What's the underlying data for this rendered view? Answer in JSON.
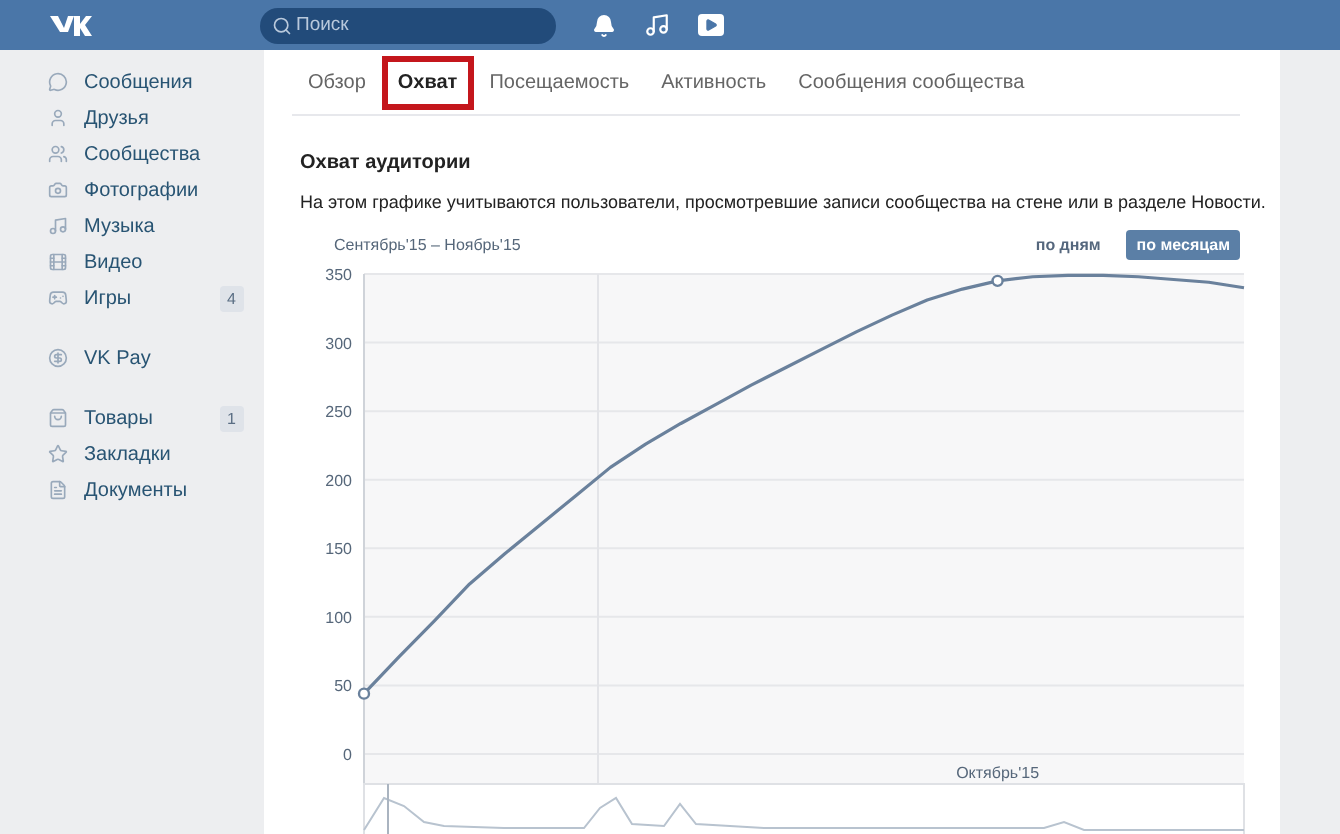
{
  "header": {
    "search": {
      "placeholder": "Поиск"
    }
  },
  "sidebar": {
    "groups": [
      [
        {
          "label": "Сообщения"
        },
        {
          "label": "Друзья"
        },
        {
          "label": "Сообщества"
        },
        {
          "label": "Фотографии"
        },
        {
          "label": "Музыка"
        },
        {
          "label": "Видео"
        },
        {
          "label": "Игры",
          "badge": "4"
        }
      ],
      [
        {
          "label": "VK Pay"
        }
      ],
      [
        {
          "label": "Товары",
          "badge": "1"
        },
        {
          "label": "Закладки"
        },
        {
          "label": "Документы"
        }
      ]
    ]
  },
  "tabs": [
    {
      "label": "Обзор",
      "selected": false,
      "highlighted": false
    },
    {
      "label": "Охват",
      "selected": true,
      "highlighted": true
    },
    {
      "label": "Посещаемость",
      "selected": false,
      "highlighted": false
    },
    {
      "label": "Активность",
      "selected": false,
      "highlighted": false
    },
    {
      "label": "Сообщения сообщества",
      "selected": false,
      "highlighted": false
    }
  ],
  "section": {
    "title": "Охват аудитории",
    "description": "На этом графике учитываются пользователи, просмотревшие записи сообщества на стене или в разделе Новости."
  },
  "chart": {
    "period": "Сентябрь'15 – Ноябрь'15",
    "modes": [
      {
        "label": "по дням",
        "selected": false
      },
      {
        "label": "по месяцам",
        "selected": true
      }
    ],
    "chart_data": {
      "type": "line",
      "categories": [
        null,
        null,
        null,
        null,
        null,
        null,
        null,
        null,
        null,
        null,
        null,
        null,
        null,
        null,
        null,
        null,
        null,
        null,
        null,
        null,
        null,
        null,
        null,
        null,
        null,
        null
      ],
      "ylim": [
        0,
        350
      ],
      "grid": true,
      "yticks": [
        {
          "value": 0,
          "label": "0"
        },
        {
          "value": 50,
          "label": "50"
        },
        {
          "value": 100,
          "label": "100"
        },
        {
          "value": 150,
          "label": "150"
        },
        {
          "value": 200,
          "label": "200"
        },
        {
          "value": 250,
          "label": "250"
        },
        {
          "value": 300,
          "label": "300"
        },
        {
          "value": 350,
          "label": "350"
        }
      ],
      "annotations": [
        "Октябрь'15"
      ],
      "series": [
        {
          "color": "#6a819c",
          "values": [
            44,
            71,
            97,
            124,
            146,
            167,
            188,
            209,
            226,
            241,
            255,
            269,
            282,
            295,
            308,
            320,
            331,
            339,
            345,
            348,
            349,
            349,
            348,
            346,
            344,
            340
          ]
        }
      ]
    }
  }
}
